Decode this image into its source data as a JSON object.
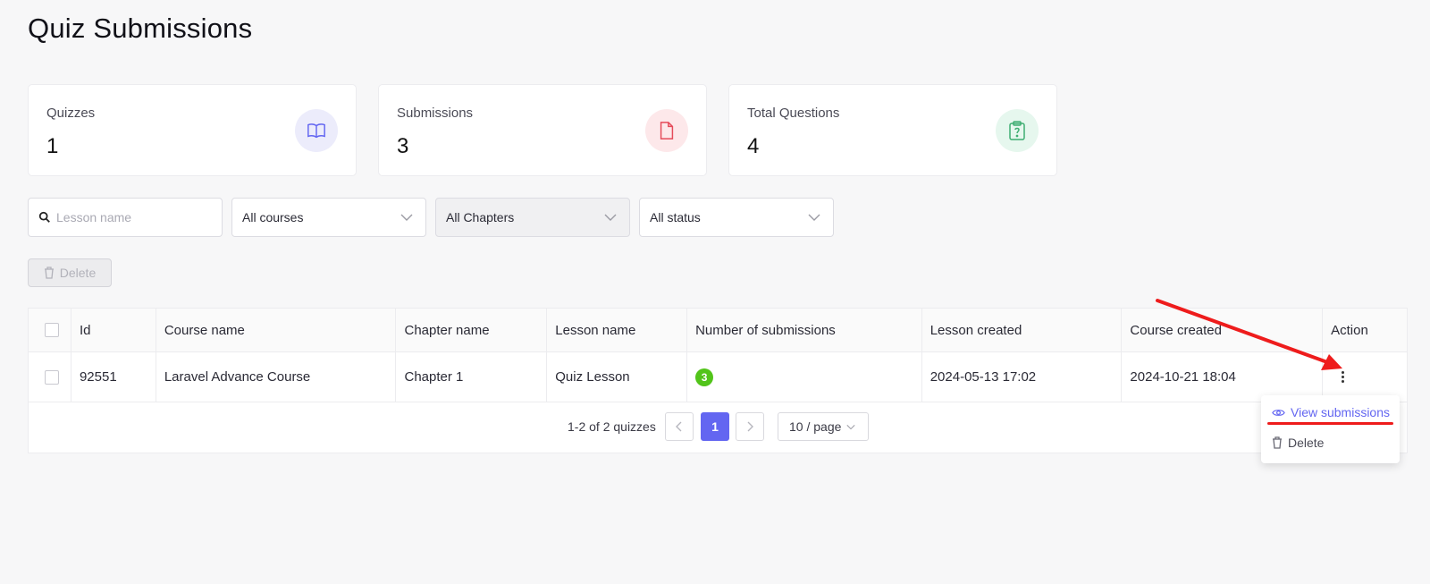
{
  "page": {
    "title": "Quiz Submissions"
  },
  "stats": [
    {
      "label": "Quizzes",
      "value": "1",
      "icon": "book-open-icon",
      "bg": "#ececfb",
      "fg": "#6366f1"
    },
    {
      "label": "Submissions",
      "value": "3",
      "icon": "file-icon",
      "bg": "#fde8ea",
      "fg": "#e54b5a"
    },
    {
      "label": "Total Questions",
      "value": "4",
      "icon": "clipboard-question-icon",
      "bg": "#e6f7ee",
      "fg": "#3fae72"
    }
  ],
  "filters": {
    "search_placeholder": "Lesson name",
    "course_select": "All courses",
    "chapter_select": "All Chapters",
    "status_select": "All status"
  },
  "toolbar": {
    "delete_label": "Delete"
  },
  "table": {
    "headers": [
      "Id",
      "Course name",
      "Chapter name",
      "Lesson name",
      "Number of submissions",
      "Lesson created",
      "Course created",
      "Action"
    ],
    "rows": [
      {
        "id": "92551",
        "course": "Laravel Advance Course",
        "chapter": "Chapter 1",
        "lesson": "Quiz Lesson",
        "submissions": "3",
        "lesson_created": "2024-05-13 17:02",
        "course_created": "2024-10-21 18:04"
      }
    ]
  },
  "pagination": {
    "summary": "1-2 of 2 quizzes",
    "current_page": "1",
    "page_size": "10 / page"
  },
  "action_menu": {
    "view_label": "View submissions",
    "delete_label": "Delete"
  },
  "annotation": {
    "color": "#ee1c1c"
  }
}
